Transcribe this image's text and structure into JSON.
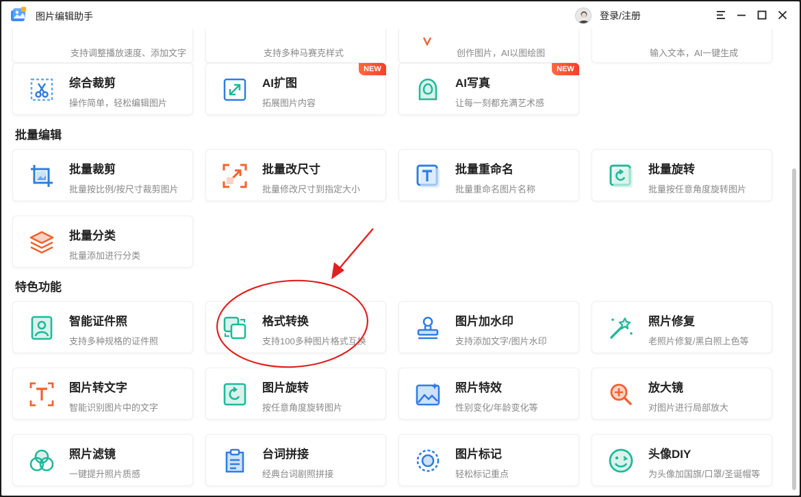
{
  "app": {
    "title": "图片编辑助手",
    "login_label": "登录/注册"
  },
  "window_controls": [
    "menu-icon",
    "minimize-icon",
    "maximize-icon",
    "close-icon"
  ],
  "top_row_partial": [
    {
      "desc": "支持调整播放速度、添加文字"
    },
    {
      "desc": "支持多种马赛克样式"
    },
    {
      "desc": "创作图片，AI以图绘图"
    },
    {
      "desc": "输入文本，AI一键生成"
    }
  ],
  "row_ai": [
    {
      "name": "综合裁剪",
      "desc": "操作简单，轻松编辑图片",
      "badge": ""
    },
    {
      "name": "AI扩图",
      "desc": "拓展图片内容",
      "badge": "NEW"
    },
    {
      "name": "AI写真",
      "desc": "让每一刻都充满艺术感",
      "badge": "NEW"
    }
  ],
  "batch": {
    "title": "批量编辑",
    "items": [
      {
        "name": "批量裁剪",
        "desc": "批量按比例/按尺寸裁剪图片"
      },
      {
        "name": "批量改尺寸",
        "desc": "批量修改尺寸到指定大小"
      },
      {
        "name": "批量重命名",
        "desc": "批量重命名图片名称"
      },
      {
        "name": "批量旋转",
        "desc": "批量按任意角度旋转图片"
      },
      {
        "name": "批量分类",
        "desc": "批量添加进行分类"
      }
    ]
  },
  "featured": {
    "title": "特色功能",
    "items": [
      {
        "name": "智能证件照",
        "desc": "支持多种规格的证件照"
      },
      {
        "name": "格式转换",
        "desc": "支持100多种图片格式互换"
      },
      {
        "name": "图片加水印",
        "desc": "支持添加文字/图片水印"
      },
      {
        "name": "照片修复",
        "desc": "老照片修复/黑白照上色等"
      },
      {
        "name": "图片转文字",
        "desc": "智能识别图片中的文字"
      },
      {
        "name": "图片旋转",
        "desc": "按任意角度旋转图片"
      },
      {
        "name": "照片特效",
        "desc": "性别变化/年龄变化等"
      },
      {
        "name": "放大镜",
        "desc": "对图片进行局部放大"
      },
      {
        "name": "照片滤镜",
        "desc": "一键提升照片质感"
      },
      {
        "name": "台词拼接",
        "desc": "经典台词剧照拼接"
      },
      {
        "name": "图片标记",
        "desc": "轻松标记重点"
      },
      {
        "name": "头像DIY",
        "desc": "为头像加国旗/口罩/圣诞帽等"
      }
    ]
  },
  "colors": {
    "accent_blue": "#2f7de1",
    "accent_teal": "#1fb89a",
    "accent_orange": "#f0622f",
    "annotation_red": "#e02020"
  }
}
